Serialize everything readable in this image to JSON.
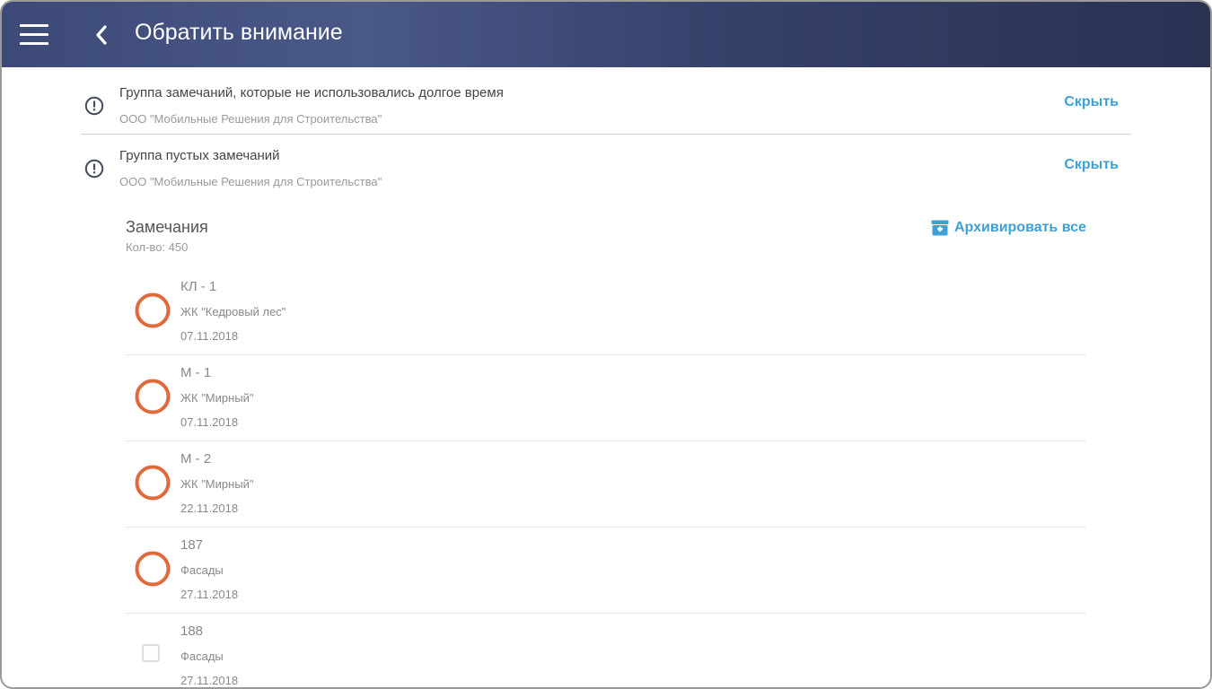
{
  "header": {
    "title": "Обратить внимание",
    "menu_icon": "hamburger-menu-icon",
    "back_icon": "chevron-left-icon"
  },
  "notices": [
    {
      "title": "Группа замечаний, которые не использовались долгое время",
      "subtitle": "ООО \"Мобильные Решения для Строительства\"",
      "action": "Скрыть"
    },
    {
      "title": "Группа пустых замечаний",
      "subtitle": "ООО \"Мобильные Решения для Строительства\"",
      "action": "Скрыть"
    }
  ],
  "remarks": {
    "title": "Замечания",
    "count": "Кол-во: 450",
    "archive_all": "Архивировать все",
    "items": [
      {
        "title": "КЛ - 1",
        "place": "ЖК \"Кедровый лес\"",
        "date": "07.11.2018",
        "status": "circle"
      },
      {
        "title": "М - 1",
        "place": "ЖК \"Мирный\"",
        "date": "07.11.2018",
        "status": "circle"
      },
      {
        "title": "М - 2",
        "place": "ЖК \"Мирный\"",
        "date": "22.11.2018",
        "status": "circle"
      },
      {
        "title": "187",
        "place": "Фасады",
        "date": "27.11.2018",
        "status": "circle"
      },
      {
        "title": "188",
        "place": "Фасады",
        "date": "27.11.2018",
        "status": "checkbox"
      }
    ]
  },
  "colors": {
    "accent": "#3ea0d8",
    "status_ring": "#e06a3e",
    "header_start": "#3d4a78",
    "header_end": "#2a3252"
  }
}
